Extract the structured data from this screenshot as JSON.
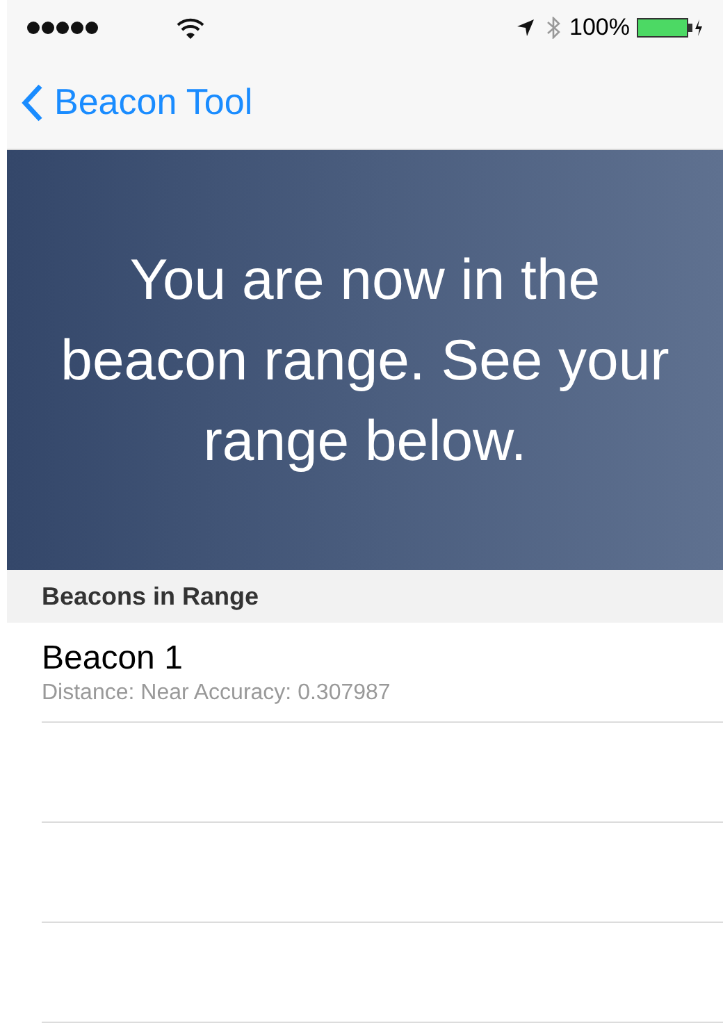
{
  "status_bar": {
    "battery": "100%"
  },
  "nav": {
    "back_label": "Beacon Tool"
  },
  "banner": {
    "message": "You are now in the beacon range. See your range below."
  },
  "section": {
    "title": "Beacons in Range"
  },
  "beacons": [
    {
      "name": "Beacon 1",
      "detail": "Distance: Near Accuracy: 0.307987"
    }
  ]
}
